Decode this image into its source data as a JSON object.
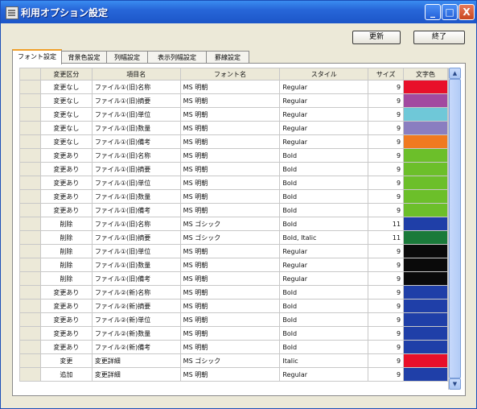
{
  "window": {
    "title": "利用オプション設定",
    "min": "_",
    "max": "□",
    "close": "X"
  },
  "toolbar": {
    "update": "更新",
    "close": "終了"
  },
  "tabs": [
    "フォント設定",
    "背景色設定",
    "列幅設定",
    "表示列幅設定",
    "罫線設定"
  ],
  "grid": {
    "headers": [
      "変更区分",
      "項目名",
      "フォント名",
      "スタイル",
      "サイズ",
      "文字色"
    ],
    "rows": [
      {
        "cat": "変更なし",
        "item": "ファイル①(旧)名称",
        "font": "MS 明朝",
        "style": "Regular",
        "size": "9",
        "color": "#e8102a"
      },
      {
        "cat": "変更なし",
        "item": "ファイル①(旧)摘要",
        "font": "MS 明朝",
        "style": "Regular",
        "size": "9",
        "color": "#a24aa0"
      },
      {
        "cat": "変更なし",
        "item": "ファイル①(旧)単位",
        "font": "MS 明朝",
        "style": "Regular",
        "size": "9",
        "color": "#6fc8d8"
      },
      {
        "cat": "変更なし",
        "item": "ファイル①(旧)数量",
        "font": "MS 明朝",
        "style": "Regular",
        "size": "9",
        "color": "#8a7ec0"
      },
      {
        "cat": "変更なし",
        "item": "ファイル①(旧)備考",
        "font": "MS 明朝",
        "style": "Regular",
        "size": "9",
        "color": "#f07a20"
      },
      {
        "cat": "変更あり",
        "item": "ファイル①(旧)名称",
        "font": "MS 明朝",
        "style": "Bold",
        "size": "9",
        "color": "#6cbf2a"
      },
      {
        "cat": "変更あり",
        "item": "ファイル①(旧)摘要",
        "font": "MS 明朝",
        "style": "Bold",
        "size": "9",
        "color": "#6cbf2a"
      },
      {
        "cat": "変更あり",
        "item": "ファイル①(旧)単位",
        "font": "MS 明朝",
        "style": "Bold",
        "size": "9",
        "color": "#6cbf2a"
      },
      {
        "cat": "変更あり",
        "item": "ファイル①(旧)数量",
        "font": "MS 明朝",
        "style": "Bold",
        "size": "9",
        "color": "#6cbf2a"
      },
      {
        "cat": "変更あり",
        "item": "ファイル①(旧)備考",
        "font": "MS 明朝",
        "style": "Bold",
        "size": "9",
        "color": "#6cbf2a"
      },
      {
        "cat": "削除",
        "item": "ファイル①(旧)名称",
        "font": "MS ゴシック",
        "style": "Bold",
        "size": "11",
        "color": "#1f3fa8"
      },
      {
        "cat": "削除",
        "item": "ファイル①(旧)摘要",
        "font": "MS ゴシック",
        "style": "Bold, Italic",
        "size": "11",
        "color": "#1a7a3a"
      },
      {
        "cat": "削除",
        "item": "ファイル①(旧)単位",
        "font": "MS 明朝",
        "style": "Regular",
        "size": "9",
        "color": "#0a0a0a"
      },
      {
        "cat": "削除",
        "item": "ファイル①(旧)数量",
        "font": "MS 明朝",
        "style": "Regular",
        "size": "9",
        "color": "#0a0a0a"
      },
      {
        "cat": "削除",
        "item": "ファイル①(旧)備考",
        "font": "MS 明朝",
        "style": "Regular",
        "size": "9",
        "color": "#0a0a0a"
      },
      {
        "cat": "変更あり",
        "item": "ファイル②(新)名称",
        "font": "MS 明朝",
        "style": "Bold",
        "size": "9",
        "color": "#1f3fa8"
      },
      {
        "cat": "変更あり",
        "item": "ファイル②(新)摘要",
        "font": "MS 明朝",
        "style": "Bold",
        "size": "9",
        "color": "#1f3fa8"
      },
      {
        "cat": "変更あり",
        "item": "ファイル②(新)単位",
        "font": "MS 明朝",
        "style": "Bold",
        "size": "9",
        "color": "#1f3fa8"
      },
      {
        "cat": "変更あり",
        "item": "ファイル②(新)数量",
        "font": "MS 明朝",
        "style": "Bold",
        "size": "9",
        "color": "#1f3fa8"
      },
      {
        "cat": "変更あり",
        "item": "ファイル②(新)備考",
        "font": "MS 明朝",
        "style": "Bold",
        "size": "9",
        "color": "#1f3fa8"
      },
      {
        "cat": "変更",
        "item": "変更詳細",
        "font": "MS ゴシック",
        "style": "Italic",
        "size": "9",
        "color": "#e8102a"
      },
      {
        "cat": "追加",
        "item": "変更詳細",
        "font": "MS 明朝",
        "style": "Regular",
        "size": "9",
        "color": "#1f3fa8"
      }
    ]
  },
  "scrollbar": {
    "up": "▲",
    "down": "▼"
  }
}
